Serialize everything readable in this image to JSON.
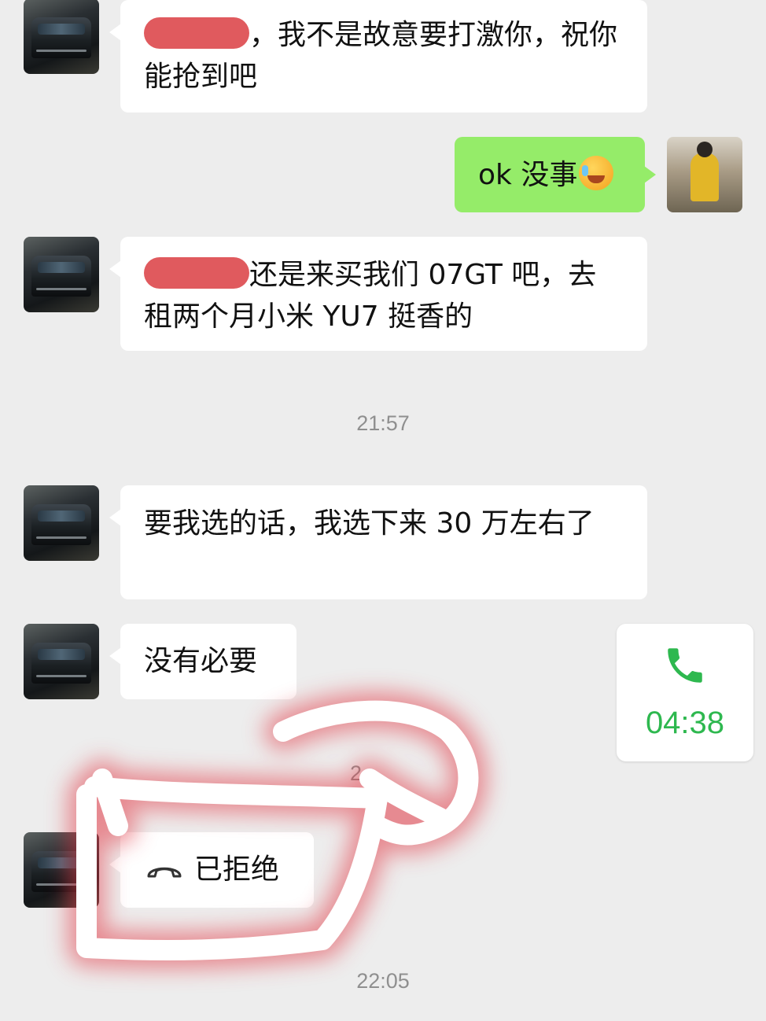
{
  "messages": [
    {
      "side": "left",
      "text_after_redaction": "，我不是故意要打激你，祝你能抢到吧"
    },
    {
      "side": "right",
      "text": "ok 没事"
    },
    {
      "side": "left",
      "text_after_redaction": "还是来买我们 07GT 吧，去租两个月小米 YU7 挺香的"
    },
    {
      "side": "left",
      "text": "要我选的话，我选下来 30 万左右了"
    },
    {
      "side": "left",
      "text": "没有必要"
    },
    {
      "side": "left",
      "text": "已拒绝",
      "type": "call-declined"
    }
  ],
  "timestamps": {
    "first": "21:57",
    "partial": "2",
    "last": "22:05"
  },
  "call_card": {
    "duration": "04:38"
  },
  "icons": {
    "contact_avatar": "dark-car-avatar",
    "my_avatar": "person-photo-avatar",
    "emoji": "facepalm-emoji",
    "call": "phone-icon",
    "hangup": "hang-up-icon"
  },
  "colors": {
    "background": "#ededed",
    "incoming_bubble": "#ffffff",
    "outgoing_bubble": "#95ec69",
    "call_green": "#2eb84f",
    "redaction": "#e05a5e",
    "annotation_glow": "#e23b46"
  }
}
